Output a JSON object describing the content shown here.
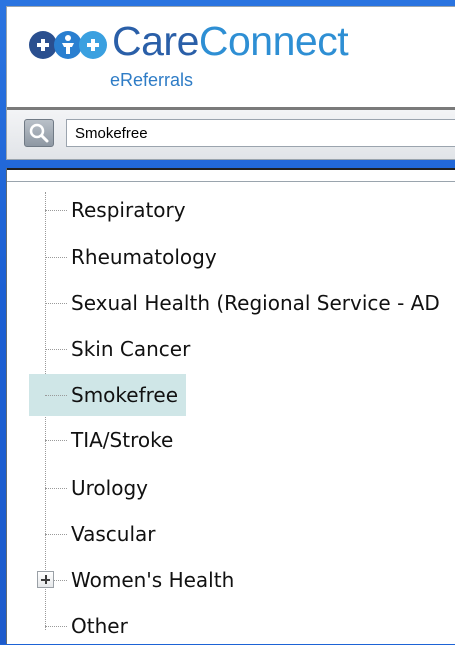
{
  "app": {
    "brand_care": "Care",
    "brand_connect": "Connect",
    "brand_subtitle": "eReferrals",
    "colors": {
      "brand_dark": "#2a5fa8",
      "brand_light": "#2e8fd4",
      "selection": "#cfe6e7",
      "background": "#1d63d6"
    }
  },
  "search": {
    "icon": "search-icon",
    "value": "Smokefree"
  },
  "tree": {
    "items": [
      {
        "label": "Respiratory",
        "selected": false,
        "expandable": false
      },
      {
        "label": "Rheumatology",
        "selected": false,
        "expandable": false
      },
      {
        "label": "Sexual Health (Regional Service - AD",
        "selected": false,
        "expandable": false
      },
      {
        "label": "Skin Cancer",
        "selected": false,
        "expandable": false
      },
      {
        "label": "Smokefree",
        "selected": true,
        "expandable": false
      },
      {
        "label": "TIA/Stroke",
        "selected": false,
        "expandable": false
      },
      {
        "label": "Urology",
        "selected": false,
        "expandable": false
      },
      {
        "label": "Vascular",
        "selected": false,
        "expandable": false
      },
      {
        "label": "Women's Health",
        "selected": false,
        "expandable": true
      },
      {
        "label": "Other",
        "selected": false,
        "expandable": false
      }
    ]
  }
}
